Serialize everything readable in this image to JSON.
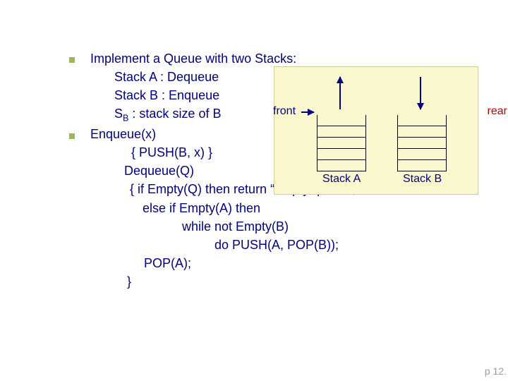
{
  "slide": {
    "title": "Implement a Queue with two Stacks:",
    "lines": {
      "stack_a": "Stack A : Dequeue",
      "stack_b": "Stack B : Enqueue",
      "sb_pre": "S",
      "sb_sub": "B",
      "sb_post": " : stack size of B",
      "enqueue": "Enqueue(x)",
      "push_b": "  { PUSH(B, x) }",
      "dequeue": "Dequeue(Q)",
      "if_empty": "{ if Empty(Q) then return “empty queue”;",
      "else_if": "  else if Empty(A) then",
      "while_not": "      while not Empty(B)",
      "do_push": "          do PUSH(A, POP(B));",
      "pop_a": "POP(A);",
      "close": "}"
    },
    "figure": {
      "front": "front",
      "rear": "rear",
      "stack_a_label": "Stack A",
      "stack_b_label": "Stack B"
    },
    "footer": "p 12."
  }
}
